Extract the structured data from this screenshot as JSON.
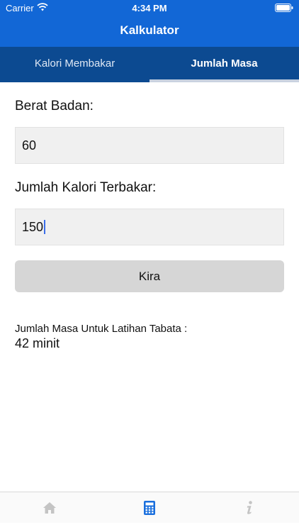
{
  "status_bar": {
    "carrier": "Carrier",
    "time": "4:34 PM"
  },
  "nav": {
    "title": "Kalkulator"
  },
  "tabs": [
    {
      "label": "Kalori Membakar",
      "active": false
    },
    {
      "label": "Jumlah Masa",
      "active": true
    }
  ],
  "form": {
    "weight_label": "Berat Badan:",
    "weight_value": "60",
    "calories_label": "Jumlah Kalori Terbakar:",
    "calories_value": "150",
    "submit_label": "Kira"
  },
  "result": {
    "label": "Jumlah Masa Untuk Latihan Tabata :",
    "value": "42 minit"
  },
  "tabbar": {
    "items": [
      {
        "icon": "home-icon",
        "active": false
      },
      {
        "icon": "calculator-icon",
        "active": true
      },
      {
        "icon": "info-icon",
        "active": false
      }
    ]
  },
  "colors": {
    "header": "#1267d6",
    "tabs": "#0c4a91",
    "active_icon": "#1a6fdd",
    "inactive_icon": "#c4c4c4"
  }
}
